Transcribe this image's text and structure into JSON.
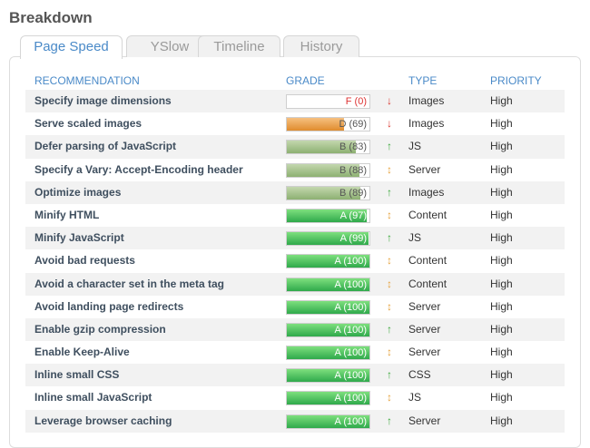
{
  "page": {
    "title": "Breakdown"
  },
  "tabs": [
    {
      "label": "Page Speed",
      "active": true
    },
    {
      "label": "YSlow",
      "active": false
    },
    {
      "label": "Timeline",
      "active": false
    },
    {
      "label": "History",
      "active": false
    }
  ],
  "table": {
    "headers": {
      "recommendation": "RECOMMENDATION",
      "grade": "GRADE",
      "type": "TYPE",
      "priority": "PRIORITY"
    },
    "rows": [
      {
        "recommendation": "Specify image dimensions",
        "grade": "F (0)",
        "score": 0,
        "letter": "F",
        "trend": "down",
        "type": "Images",
        "priority": "High"
      },
      {
        "recommendation": "Serve scaled images",
        "grade": "D (69)",
        "score": 69,
        "letter": "D",
        "trend": "down",
        "type": "Images",
        "priority": "High"
      },
      {
        "recommendation": "Defer parsing of JavaScript",
        "grade": "B (83)",
        "score": 83,
        "letter": "B",
        "trend": "up",
        "type": "JS",
        "priority": "High"
      },
      {
        "recommendation": "Specify a Vary: Accept-Encoding header",
        "grade": "B (88)",
        "score": 88,
        "letter": "B",
        "trend": "neutral",
        "type": "Server",
        "priority": "High"
      },
      {
        "recommendation": "Optimize images",
        "grade": "B (89)",
        "score": 89,
        "letter": "B",
        "trend": "up",
        "type": "Images",
        "priority": "High"
      },
      {
        "recommendation": "Minify HTML",
        "grade": "A (97)",
        "score": 97,
        "letter": "A",
        "trend": "neutral",
        "type": "Content",
        "priority": "High"
      },
      {
        "recommendation": "Minify JavaScript",
        "grade": "A (99)",
        "score": 99,
        "letter": "A",
        "trend": "up",
        "type": "JS",
        "priority": "High"
      },
      {
        "recommendation": "Avoid bad requests",
        "grade": "A (100)",
        "score": 100,
        "letter": "A",
        "trend": "neutral",
        "type": "Content",
        "priority": "High"
      },
      {
        "recommendation": "Avoid a character set in the meta tag",
        "grade": "A (100)",
        "score": 100,
        "letter": "A",
        "trend": "neutral",
        "type": "Content",
        "priority": "High"
      },
      {
        "recommendation": "Avoid landing page redirects",
        "grade": "A (100)",
        "score": 100,
        "letter": "A",
        "trend": "neutral",
        "type": "Server",
        "priority": "High"
      },
      {
        "recommendation": "Enable gzip compression",
        "grade": "A (100)",
        "score": 100,
        "letter": "A",
        "trend": "up",
        "type": "Server",
        "priority": "High"
      },
      {
        "recommendation": "Enable Keep-Alive",
        "grade": "A (100)",
        "score": 100,
        "letter": "A",
        "trend": "neutral",
        "type": "Server",
        "priority": "High"
      },
      {
        "recommendation": "Inline small CSS",
        "grade": "A (100)",
        "score": 100,
        "letter": "A",
        "trend": "up",
        "type": "CSS",
        "priority": "High"
      },
      {
        "recommendation": "Inline small JavaScript",
        "grade": "A (100)",
        "score": 100,
        "letter": "A",
        "trend": "neutral",
        "type": "JS",
        "priority": "High"
      },
      {
        "recommendation": "Leverage browser caching",
        "grade": "A (100)",
        "score": 100,
        "letter": "A",
        "trend": "up",
        "type": "Server",
        "priority": "High"
      }
    ]
  },
  "icons": {
    "down": "arrow-down-icon",
    "up": "arrow-up-icon",
    "neutral": "arrow-updown-icon"
  },
  "colors": {
    "down": "#d9342b",
    "up": "#3aa83a",
    "neutral": "#e6a23c",
    "accent": "#4a8ac8"
  }
}
